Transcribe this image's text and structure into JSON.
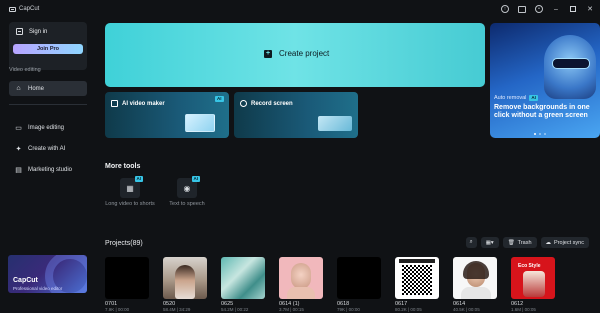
{
  "app": {
    "title": "CapCut"
  },
  "sidebar": {
    "signin_label": "Sign in",
    "join_pro_label": "Join Pro",
    "section_video_editing": "Video editing",
    "home_label": "Home",
    "image_editing_label": "Image editing",
    "create_with_ai_label": "Create with AI",
    "marketing_studio_label": "Marketing studio",
    "promo": {
      "title": "CapCut",
      "subtitle": "Professional video editor"
    }
  },
  "main": {
    "create_project_label": "Create project",
    "ai_video_maker": {
      "label": "AI video maker",
      "badge": "AI"
    },
    "record_screen": {
      "label": "Record screen"
    },
    "banner": {
      "title": "Auto removal",
      "badge": "AI",
      "text": "Remove backgrounds in one click without a green screen"
    },
    "more_tools": {
      "title": "More tools",
      "tools": [
        {
          "label": "Long video to shorts",
          "badge": "AI"
        },
        {
          "label": "Text to speech",
          "badge": "AI"
        }
      ]
    },
    "projects": {
      "title": "Projects(89)",
      "trash_label": "Trash",
      "sync_label": "Project sync",
      "items": [
        {
          "name": "0701",
          "meta": "7.9K | 00:00"
        },
        {
          "name": "0520",
          "meta": "58.4M | 34:29"
        },
        {
          "name": "0625",
          "meta": "54.2M | 00:22"
        },
        {
          "name": "0614 (1)",
          "meta": "3.7M | 00:15"
        },
        {
          "name": "0618",
          "meta": "79K | 00:00"
        },
        {
          "name": "0617",
          "meta": "80.2K | 00:05"
        },
        {
          "name": "0614",
          "meta": "40.5K | 00:05"
        },
        {
          "name": "0612",
          "meta": "1.6M | 00:05"
        }
      ],
      "poster_text": "Eco Style"
    }
  },
  "colors": {
    "background": "#101215",
    "accent_cyan": "#46cbd3",
    "badge": "#37c5e6"
  }
}
